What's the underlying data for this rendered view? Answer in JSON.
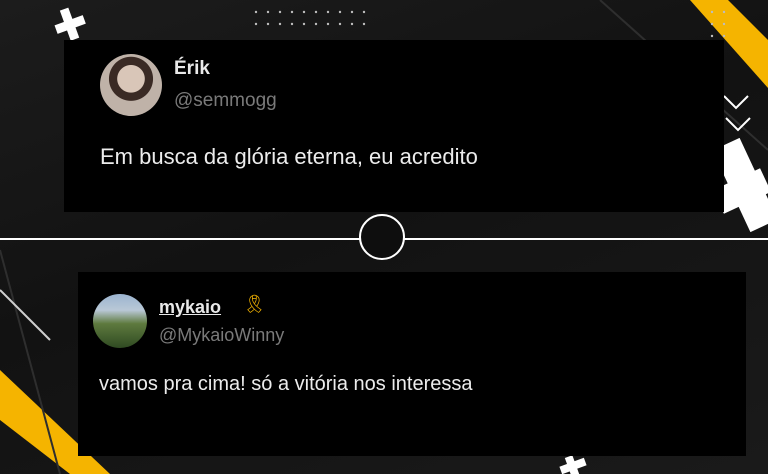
{
  "tweets": [
    {
      "name": "Érik",
      "handle": "@semmogg",
      "text": "Em busca da glória eterna, eu acredito"
    },
    {
      "name": "mykaio",
      "badge_icon": "ribbon-icon",
      "handle": "@MykaioWinny",
      "text": "vamos pra cima! só a vitória nos interessa"
    }
  ],
  "colors": {
    "accent": "#f5b400",
    "card_bg": "#000000",
    "divider": "#ffffff"
  }
}
